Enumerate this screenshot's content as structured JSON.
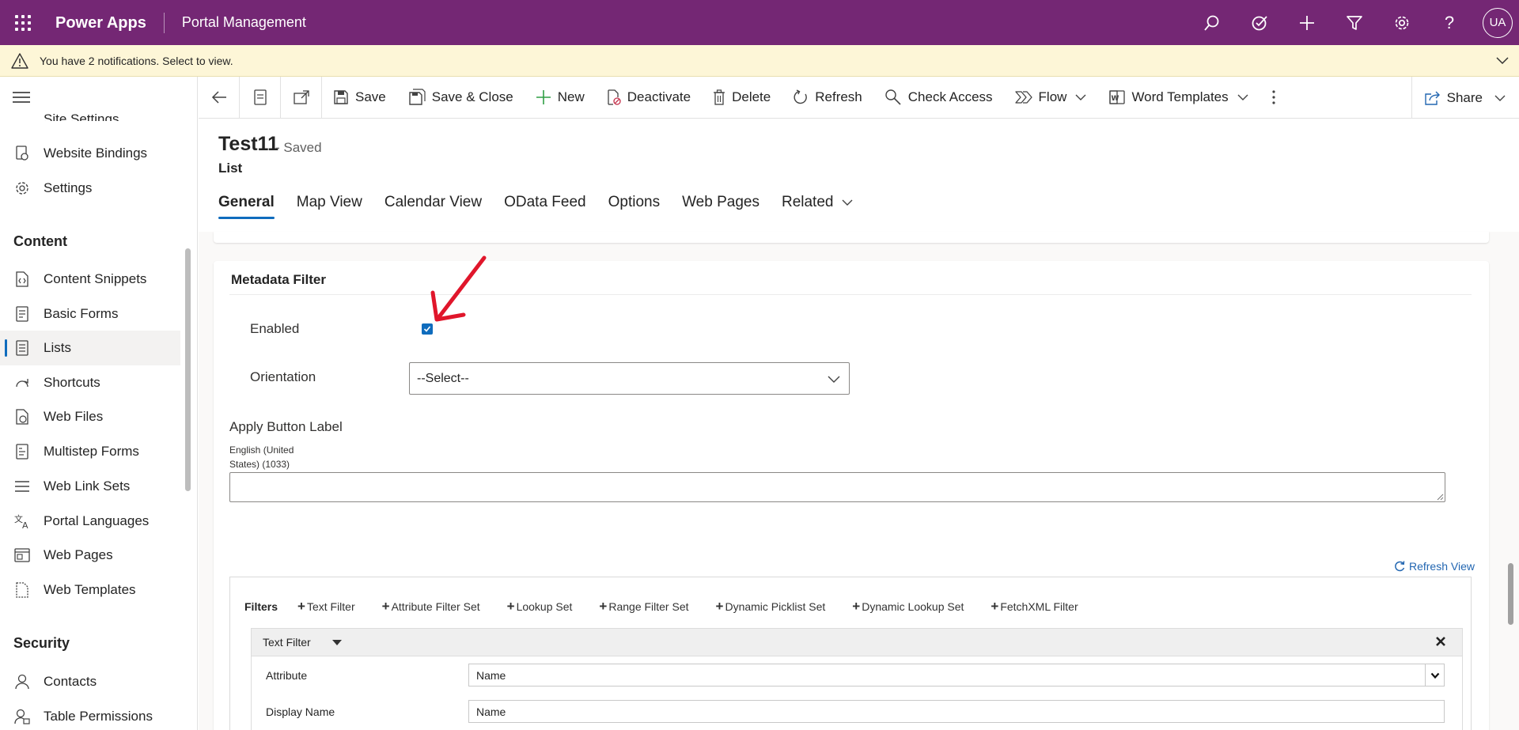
{
  "topbar": {
    "app_name": "Power Apps",
    "portal_name": "Portal Management",
    "avatar_initials": "UA",
    "icons": [
      "search-icon",
      "task-check-icon",
      "add-icon",
      "filter-icon",
      "settings-icon",
      "help-icon"
    ]
  },
  "notification": {
    "text": "You have 2 notifications. Select to view."
  },
  "sidebar": {
    "items_top": [
      {
        "label": "Site Settings",
        "icon": "site-settings-icon"
      },
      {
        "label": "Website Bindings",
        "icon": "website-bindings-icon"
      },
      {
        "label": "Settings",
        "icon": "gear-icon"
      }
    ],
    "content_section": "Content",
    "content_items": [
      {
        "label": "Content Snippets",
        "icon": "snippet-icon"
      },
      {
        "label": "Basic Forms",
        "icon": "form-icon"
      },
      {
        "label": "Lists",
        "icon": "list-icon",
        "active": true
      },
      {
        "label": "Shortcuts",
        "icon": "shortcut-icon"
      },
      {
        "label": "Web Files",
        "icon": "web-file-icon"
      },
      {
        "label": "Multistep Forms",
        "icon": "multistep-form-icon"
      },
      {
        "label": "Web Link Sets",
        "icon": "link-set-icon"
      },
      {
        "label": "Portal Languages",
        "icon": "language-icon"
      },
      {
        "label": "Web Pages",
        "icon": "web-page-icon"
      },
      {
        "label": "Web Templates",
        "icon": "template-icon"
      }
    ],
    "security_section": "Security",
    "security_items": [
      {
        "label": "Contacts",
        "icon": "contact-icon"
      },
      {
        "label": "Table Permissions",
        "icon": "permission-icon"
      }
    ]
  },
  "commands": {
    "save": "Save",
    "save_close": "Save & Close",
    "new": "New",
    "deactivate": "Deactivate",
    "delete": "Delete",
    "refresh": "Refresh",
    "check_access": "Check Access",
    "flow": "Flow",
    "word_templates": "Word Templates",
    "share": "Share"
  },
  "record": {
    "title": "Test11",
    "status": "- Saved",
    "type": "List"
  },
  "tabs": [
    "General",
    "Map View",
    "Calendar View",
    "OData Feed",
    "Options",
    "Web Pages",
    "Related"
  ],
  "section": {
    "title": "Metadata Filter",
    "enabled_label": "Enabled",
    "enabled_checked": true,
    "orientation_label": "Orientation",
    "orientation_value": "--Select--",
    "apply_button_label": "Apply Button Label",
    "language_line1": "English (United",
    "language_line2": "States) (1033)",
    "apply_button_value": "",
    "refresh_view": "Refresh View"
  },
  "filters": {
    "label": "Filters",
    "buttons": [
      "Text Filter",
      "Attribute Filter Set",
      "Lookup Set",
      "Range Filter Set",
      "Dynamic Picklist Set",
      "Dynamic Lookup Set",
      "FetchXML Filter"
    ],
    "panel_title": "Text Filter",
    "attribute_label": "Attribute",
    "attribute_value": "Name",
    "display_name_label": "Display Name",
    "display_name_value": "Name"
  },
  "colors": {
    "topbar": "#742774",
    "notification_bg": "#fdf6d7",
    "accent": "#0f6cbd",
    "annotation_arrow": "#e0162b"
  }
}
